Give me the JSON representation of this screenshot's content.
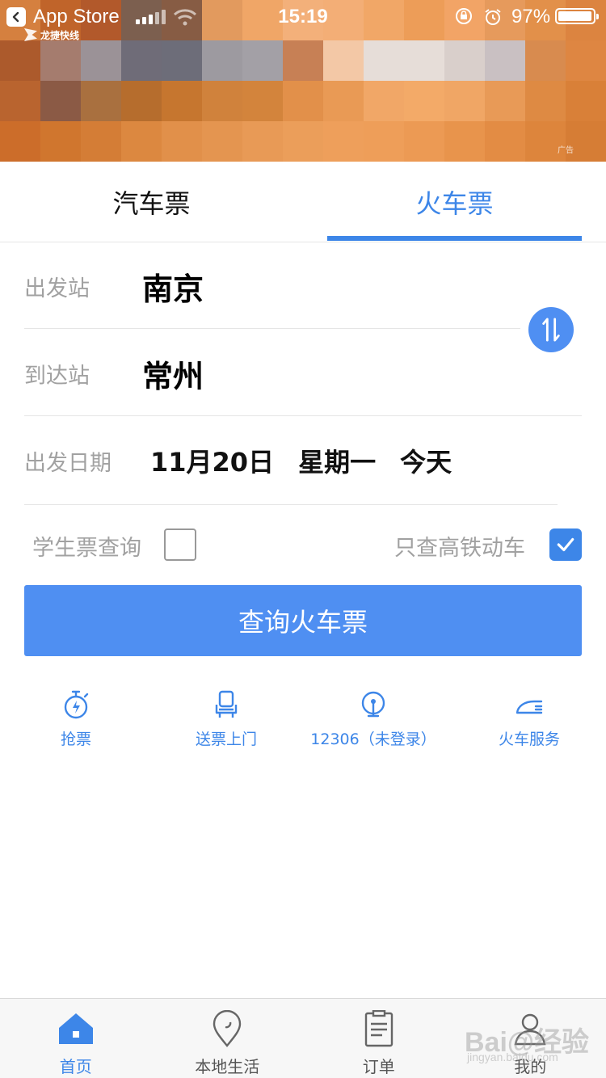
{
  "status_bar": {
    "back_app": "App Store",
    "time": "15:19",
    "battery_pct": "97%",
    "battery_level": 0.97
  },
  "banner": {
    "logo_text": "龙捷快线",
    "ad_tag": "广告",
    "mosaic_colors": [
      "#d5803f",
      "#c0642a",
      "#b2592b",
      "#7c5f4f",
      "#875c44",
      "#e29a5e",
      "#f0a667",
      "#f3b07a",
      "#f3ae76",
      "#f1a767",
      "#ed9d58",
      "#f2a466",
      "#e69a5c",
      "#e2904a",
      "#dc8440",
      "#ac5a2c",
      "#a57c6e",
      "#9b9297",
      "#6f6c78",
      "#6d6d79",
      "#9d9aa0",
      "#a3a0a6",
      "#c78055",
      "#f3c8a6",
      "#e6ddd8",
      "#e6ddd8",
      "#d9cfcb",
      "#c9c0c2",
      "#d88b4f",
      "#de8642",
      "#b9642f",
      "#8b5a45",
      "#a9703f",
      "#b66d2d",
      "#c6762f",
      "#d0823c",
      "#d3843c",
      "#e2904a",
      "#e99a55",
      "#f1a767",
      "#f3aa68",
      "#f0a665",
      "#e89a57",
      "#de8a43",
      "#d98038",
      "#cc6d2a",
      "#d0762e",
      "#d47d36",
      "#dc8840",
      "#e1904a",
      "#e49550",
      "#e89a56",
      "#eb9e5a",
      "#ee9f5b",
      "#ee9e59",
      "#ec9a54",
      "#e8944c",
      "#e38c44",
      "#dd853c",
      "#d67d35"
    ]
  },
  "tabs": [
    {
      "label": "汽车票",
      "active": false
    },
    {
      "label": "火车票",
      "active": true
    }
  ],
  "form": {
    "departure_label": "出发站",
    "departure_value": "南京",
    "arrival_label": "到达站",
    "arrival_value": "常州",
    "date_label": "出发日期",
    "date_value": "11月20日",
    "weekday": "星期一",
    "relative_day": "今天",
    "student_label": "学生票查询",
    "student_checked": false,
    "gaotie_label": "只查高铁动车",
    "gaotie_checked": true,
    "search_button": "查询火车票"
  },
  "quick_links": [
    {
      "label": "抢票",
      "icon": "stopwatch-bolt-icon"
    },
    {
      "label": "送票上门",
      "icon": "seat-icon"
    },
    {
      "label": "12306（未登录）",
      "icon": "globe-pin-icon"
    },
    {
      "label": "火车服务",
      "icon": "train-icon"
    }
  ],
  "bottom_nav": [
    {
      "label": "首页",
      "icon": "home-icon",
      "active": true
    },
    {
      "label": "本地生活",
      "icon": "location-pin-icon",
      "active": false
    },
    {
      "label": "订单",
      "icon": "order-clipboard-icon",
      "active": false
    },
    {
      "label": "我的",
      "icon": "user-icon",
      "active": false
    }
  ],
  "watermark": {
    "text": "Bai@经验",
    "sub": "jingyan.baidu.com"
  },
  "colors": {
    "accent": "#3d86e8",
    "button": "#4f8ff2",
    "label_gray": "#a1a1a1"
  }
}
